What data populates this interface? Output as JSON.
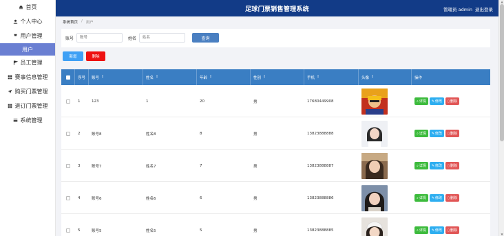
{
  "sidebar": {
    "items": [
      {
        "label": "首页",
        "icon": "home-icon",
        "glyph": "⌂"
      },
      {
        "label": "个人中心",
        "icon": "person-icon",
        "glyph": "●"
      },
      {
        "label": "用户管理",
        "icon": "pin-icon",
        "glyph": "▼"
      },
      {
        "label": "用户",
        "icon": "",
        "glyph": "",
        "active": true
      },
      {
        "label": "员工管理",
        "icon": "flag-icon",
        "glyph": "⚑"
      },
      {
        "label": "赛事信息管理",
        "icon": "grid-icon",
        "glyph": "▦"
      },
      {
        "label": "购买门票管理",
        "icon": "send-icon",
        "glyph": "➤"
      },
      {
        "label": "退订门票管理",
        "icon": "grid-icon",
        "glyph": "▦"
      },
      {
        "label": "系统管理",
        "icon": "list-icon",
        "glyph": "≡"
      }
    ]
  },
  "header": {
    "title": "足球门票销售管理系统",
    "role_label": "管理员 admin",
    "logout_label": "退出登录"
  },
  "breadcrumb": {
    "home": "系统首页",
    "separator": "/",
    "current": "用户"
  },
  "search": {
    "account_label": "账号",
    "account_placeholder": "账号",
    "name_label": "姓名",
    "name_placeholder": "姓名",
    "query_button": "查询"
  },
  "actions": {
    "add_label": "新增",
    "delete_label": "删除"
  },
  "table": {
    "headers": {
      "index": "序号",
      "account": "账号",
      "name": "姓名",
      "age": "年龄",
      "gender": "性别",
      "phone": "手机",
      "avatar": "头像",
      "ops": "操作"
    },
    "sort_glyph": "⇕",
    "op_labels": {
      "detail": "详情",
      "edit": "修改",
      "remove": "删除"
    },
    "rows": [
      {
        "index": "1",
        "account": "123",
        "name": "1",
        "age": "20",
        "gender": "男",
        "phone": "17680449908"
      },
      {
        "index": "2",
        "account": "账号8",
        "name": "姓名8",
        "age": "8",
        "gender": "男",
        "phone": "13823888888"
      },
      {
        "index": "3",
        "account": "账号7",
        "name": "姓名7",
        "age": "7",
        "gender": "男",
        "phone": "13823888887"
      },
      {
        "index": "4",
        "account": "账号6",
        "name": "姓名6",
        "age": "6",
        "gender": "男",
        "phone": "13823888886"
      },
      {
        "index": "5",
        "account": "账号5",
        "name": "姓名5",
        "age": "5",
        "gender": "男",
        "phone": "13823888885"
      }
    ]
  },
  "colors": {
    "header_bg": "#123b87",
    "table_header_bg": "#3a7ec3",
    "active_nav_bg": "#6a7fd2",
    "query_btn": "#4a7fc1",
    "add_btn": "#3fa0f5",
    "delete_btn": "#ee1111",
    "detail_btn": "#3dbb3d",
    "edit_btn": "#2eaef0",
    "remove_btn": "#e15656"
  }
}
